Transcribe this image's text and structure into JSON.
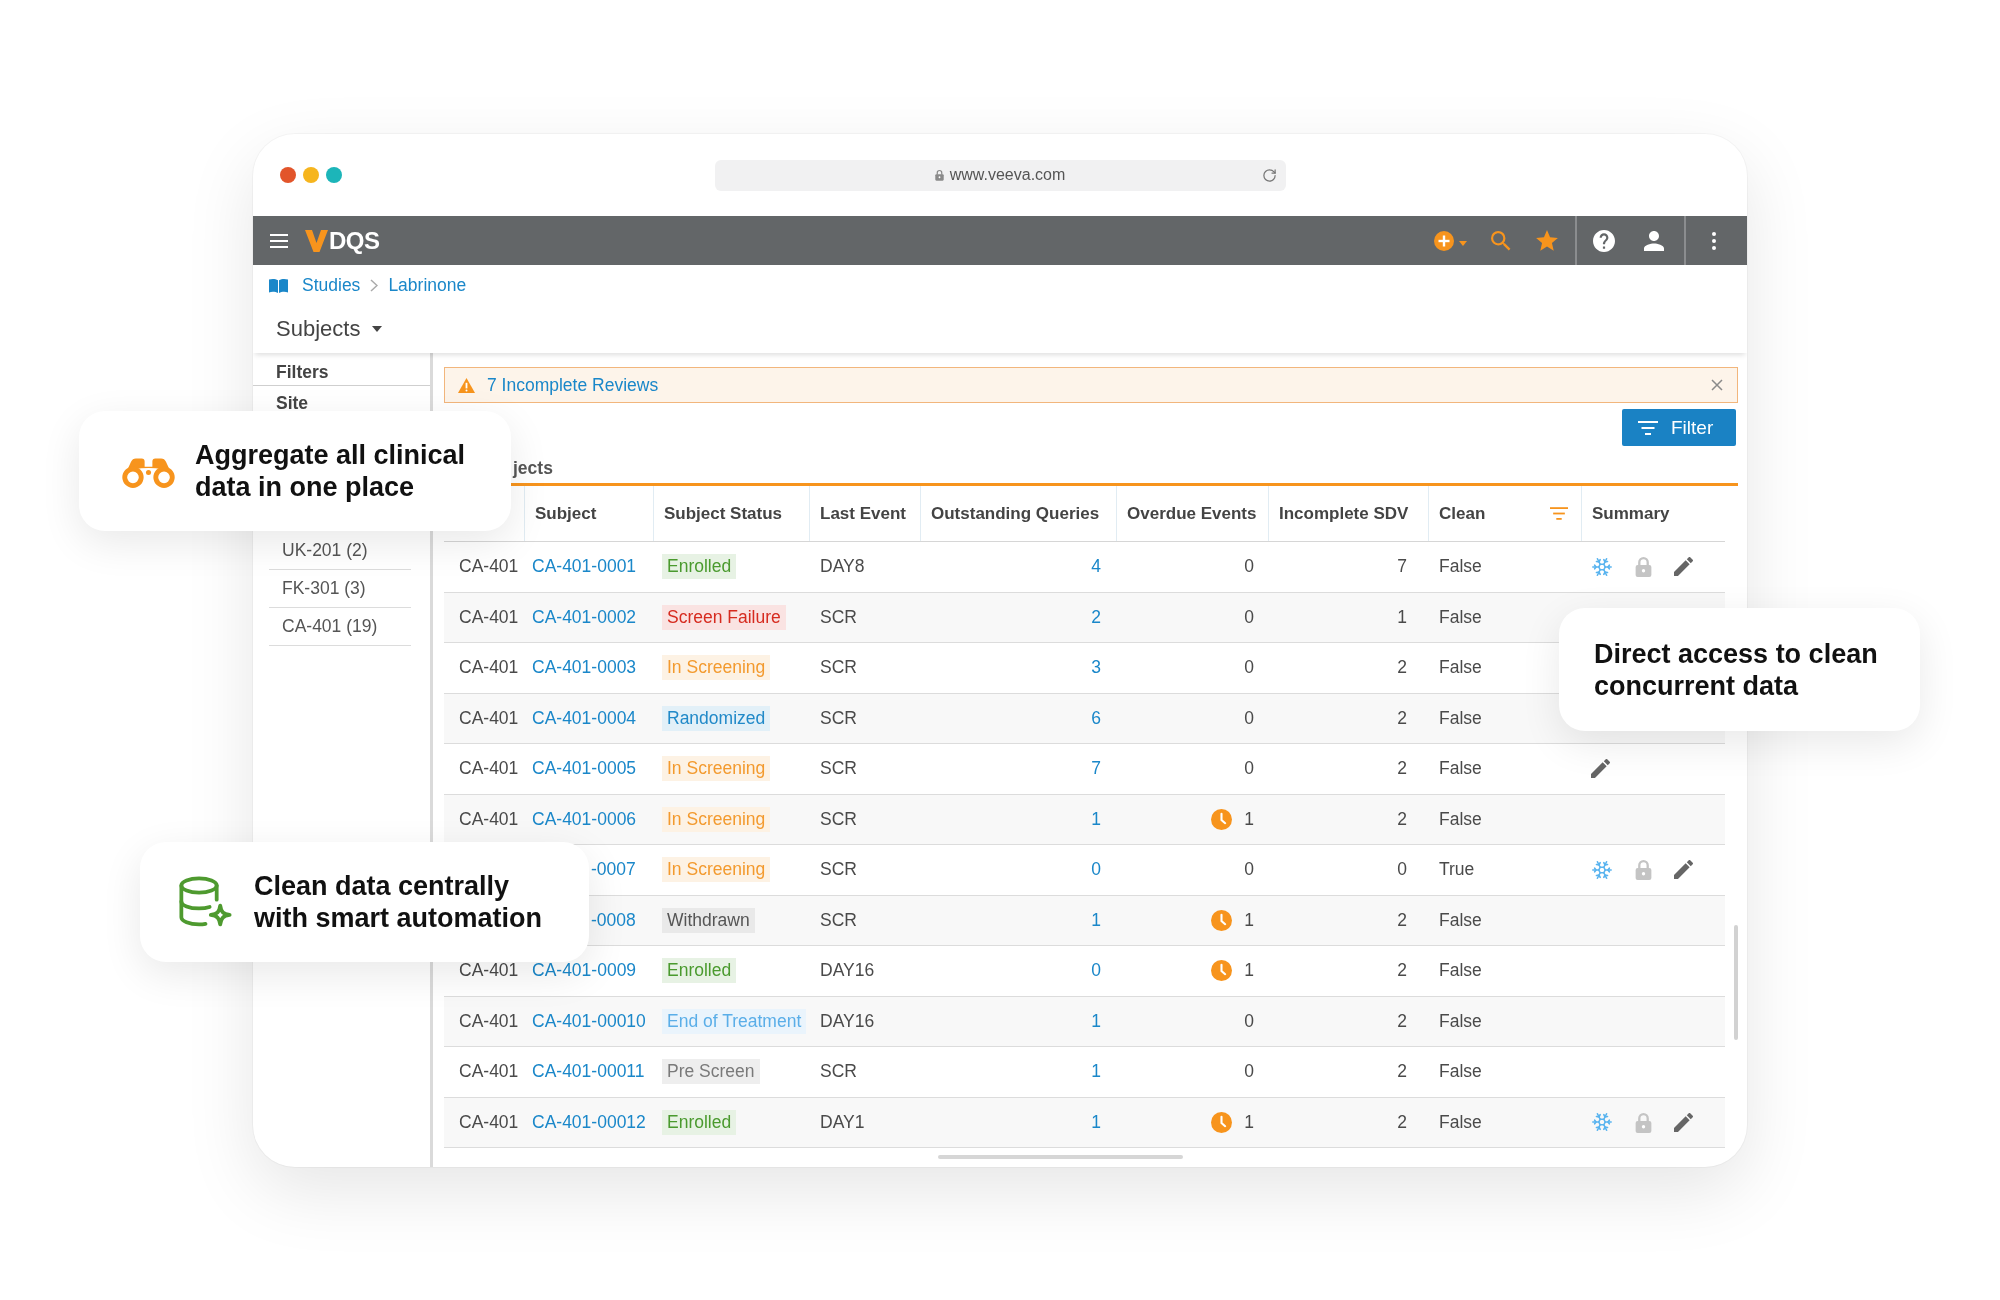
{
  "browser": {
    "url": "www.veeva.com"
  },
  "app_bar": {
    "app_name": "DQS"
  },
  "breadcrumb": [
    {
      "label": "Studies"
    },
    {
      "label": "Labrinone"
    }
  ],
  "page_title": "Subjects",
  "sidebar": {
    "title": "Filters",
    "section": "Site",
    "items": [
      {
        "label": "UK-201 (2)"
      },
      {
        "label": "FK-301 (3)"
      },
      {
        "label": "CA-401 (19)"
      }
    ]
  },
  "alert": {
    "text": "7 Incomplete Reviews"
  },
  "filter_button": {
    "label": "Filter"
  },
  "table": {
    "title": "jects",
    "columns": [
      "Subject",
      "Subject Status",
      "Last Event",
      "Outstanding Queries",
      "Overdue Events",
      "Incomplete SDV",
      "Clean",
      "Summary"
    ],
    "rows": [
      {
        "site": "CA-401",
        "subject": "CA-401-0001",
        "status": {
          "label": "Enrolled",
          "color": "#4a9a2e"
        },
        "last_event": "DAY8",
        "outstanding_queries": "4",
        "overdue_events": "0",
        "overdue_alert": false,
        "incomplete_sdv": "7",
        "clean": "False",
        "summary": [
          {
            "kind": "freeze"
          },
          {
            "kind": "lock"
          },
          {
            "kind": "edit"
          }
        ]
      },
      {
        "site": "CA-401",
        "subject": "CA-401-0002",
        "status": {
          "label": "Screen Failure",
          "color": "#d62b1f"
        },
        "last_event": "SCR",
        "outstanding_queries": "2",
        "overdue_events": "0",
        "overdue_alert": false,
        "incomplete_sdv": "1",
        "clean": "False"
      },
      {
        "site": "CA-401",
        "subject": "CA-401-0003",
        "status": {
          "label": "In Screening",
          "color": "#f39a2e"
        },
        "last_event": "SCR",
        "outstanding_queries": "3",
        "overdue_events": "0",
        "overdue_alert": false,
        "incomplete_sdv": "2",
        "clean": "False"
      },
      {
        "site": "CA-401",
        "subject": "CA-401-0004",
        "status": {
          "label": "Randomized",
          "color": "#2089c8"
        },
        "last_event": "SCR",
        "outstanding_queries": "6",
        "overdue_events": "0",
        "overdue_alert": false,
        "incomplete_sdv": "2",
        "clean": "False"
      },
      {
        "site": "CA-401",
        "subject": "CA-401-0005",
        "status": {
          "label": "In Screening",
          "color": "#f39a2e"
        },
        "last_event": "SCR",
        "outstanding_queries": "7",
        "overdue_events": "0",
        "overdue_alert": false,
        "incomplete_sdv": "2",
        "clean": "False",
        "summary": [
          {
            "kind": "edit"
          }
        ]
      },
      {
        "site": "CA-401",
        "subject": "CA-401-0006",
        "status": {
          "label": "In Screening",
          "color": "#f39a2e"
        },
        "last_event": "SCR",
        "outstanding_queries": "1",
        "overdue_events": "1",
        "overdue_alert": true,
        "incomplete_sdv": "2",
        "clean": "False"
      },
      {
        "subject": "-0007",
        "status": {
          "label": "In Screening",
          "color": "#f39a2e"
        },
        "last_event": "SCR",
        "outstanding_queries": "0",
        "overdue_events": "0",
        "overdue_alert": false,
        "incomplete_sdv": "0",
        "clean": "True",
        "summary": [
          {
            "kind": "freeze"
          },
          {
            "kind": "lock"
          },
          {
            "kind": "edit"
          }
        ]
      },
      {
        "subject": "-0008",
        "status": {
          "label": "Withdrawn",
          "color": "#555555"
        },
        "last_event": "SCR",
        "outstanding_queries": "1",
        "overdue_events": "1",
        "overdue_alert": true,
        "incomplete_sdv": "2",
        "clean": "False"
      },
      {
        "site": "CA-401",
        "subject": "CA-401-0009",
        "status": {
          "label": "Enrolled",
          "color": "#4a9a2e"
        },
        "last_event": "DAY16",
        "outstanding_queries": "0",
        "overdue_events": "1",
        "overdue_alert": true,
        "incomplete_sdv": "2",
        "clean": "False"
      },
      {
        "site": "CA-401",
        "subject": "CA-401-00010",
        "status": {
          "label": "End of Treatment",
          "color": "#5aaee8"
        },
        "last_event": "DAY16",
        "outstanding_queries": "1",
        "overdue_events": "0",
        "overdue_alert": false,
        "incomplete_sdv": "2",
        "clean": "False"
      },
      {
        "site": "CA-401",
        "subject": "CA-401-00011",
        "status": {
          "label": "Pre Screen",
          "color": "#7a7a7a"
        },
        "last_event": "SCR",
        "outstanding_queries": "1",
        "overdue_events": "0",
        "overdue_alert": false,
        "incomplete_sdv": "2",
        "clean": "False"
      },
      {
        "site": "CA-401",
        "subject": "CA-401-00012",
        "status": {
          "label": "Enrolled",
          "color": "#4a9a2e"
        },
        "last_event": "DAY1",
        "outstanding_queries": "1",
        "overdue_events": "1",
        "overdue_alert": true,
        "incomplete_sdv": "2",
        "clean": "False",
        "summary": [
          {
            "kind": "freeze"
          },
          {
            "kind": "lock"
          },
          {
            "kind": "edit"
          }
        ]
      }
    ]
  },
  "callouts": [
    {
      "text": "Aggregate all clinical data in one place",
      "kind": "icon"
    },
    {
      "text": "Direct access to clean concurrent data",
      "kind": "text"
    },
    {
      "text": "Clean data centrally with smart automation",
      "kind": "icon"
    }
  ]
}
